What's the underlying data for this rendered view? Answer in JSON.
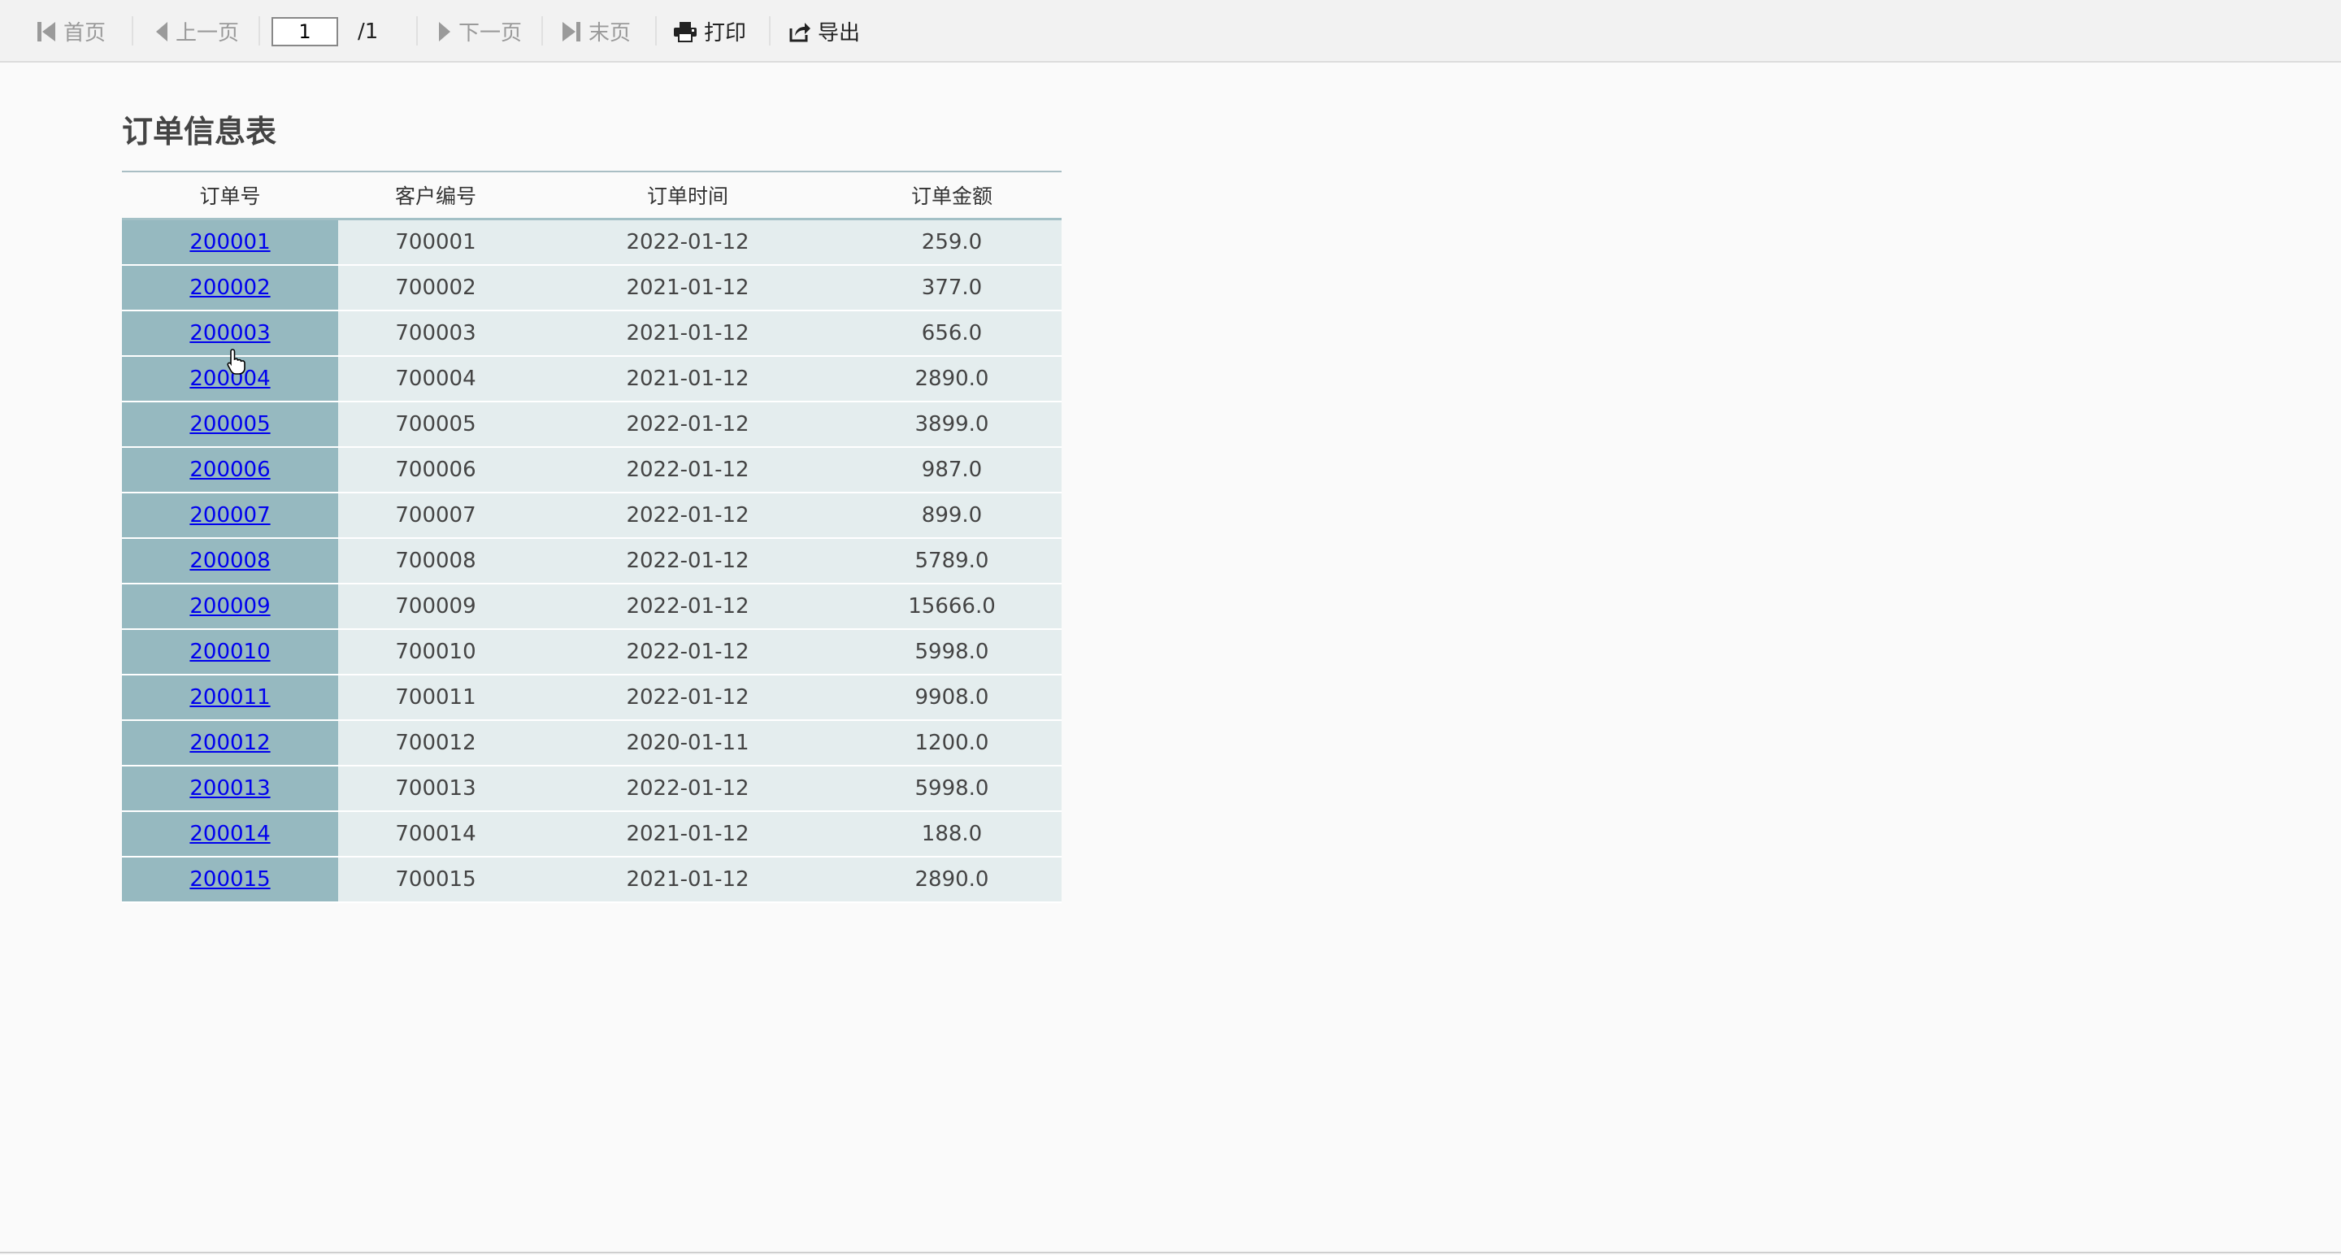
{
  "toolbar": {
    "first_label": "首页",
    "prev_label": "上一页",
    "page_value": "1",
    "page_total": "/1",
    "next_label": "下一页",
    "last_label": "末页",
    "print_label": "打印",
    "export_label": "导出"
  },
  "report": {
    "title": "订单信息表",
    "columns": [
      "订单号",
      "客户编号",
      "订单时间",
      "订单金额"
    ],
    "rows": [
      {
        "order_id": "200001",
        "customer_id": "700001",
        "order_date": "2022-01-12",
        "amount": "259.0"
      },
      {
        "order_id": "200002",
        "customer_id": "700002",
        "order_date": "2021-01-12",
        "amount": "377.0"
      },
      {
        "order_id": "200003",
        "customer_id": "700003",
        "order_date": "2021-01-12",
        "amount": "656.0"
      },
      {
        "order_id": "200004",
        "customer_id": "700004",
        "order_date": "2021-01-12",
        "amount": "2890.0"
      },
      {
        "order_id": "200005",
        "customer_id": "700005",
        "order_date": "2022-01-12",
        "amount": "3899.0"
      },
      {
        "order_id": "200006",
        "customer_id": "700006",
        "order_date": "2022-01-12",
        "amount": "987.0"
      },
      {
        "order_id": "200007",
        "customer_id": "700007",
        "order_date": "2022-01-12",
        "amount": "899.0"
      },
      {
        "order_id": "200008",
        "customer_id": "700008",
        "order_date": "2022-01-12",
        "amount": "5789.0"
      },
      {
        "order_id": "200009",
        "customer_id": "700009",
        "order_date": "2022-01-12",
        "amount": "15666.0"
      },
      {
        "order_id": "200010",
        "customer_id": "700010",
        "order_date": "2022-01-12",
        "amount": "5998.0"
      },
      {
        "order_id": "200011",
        "customer_id": "700011",
        "order_date": "2022-01-12",
        "amount": "9908.0"
      },
      {
        "order_id": "200012",
        "customer_id": "700012",
        "order_date": "2020-01-11",
        "amount": "1200.0"
      },
      {
        "order_id": "200013",
        "customer_id": "700013",
        "order_date": "2022-01-12",
        "amount": "5998.0"
      },
      {
        "order_id": "200014",
        "customer_id": "700014",
        "order_date": "2021-01-12",
        "amount": "188.0"
      },
      {
        "order_id": "200015",
        "customer_id": "700015",
        "order_date": "2021-01-12",
        "amount": "2890.0"
      }
    ]
  },
  "colors": {
    "key_cell_bg": "#96b9c0",
    "data_cell_bg": "#e4edee",
    "link": "#0000ee"
  },
  "icons": {
    "first": "skip-first-icon",
    "prev": "triangle-left-icon",
    "next": "triangle-right-icon",
    "last": "skip-last-icon",
    "print": "printer-icon",
    "export": "export-icon"
  }
}
